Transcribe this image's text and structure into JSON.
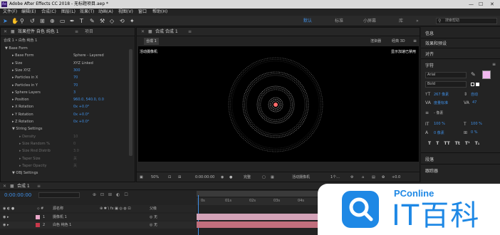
{
  "window": {
    "app_badge": "Ae",
    "title": "Adobe After Effects CC 2018 - 无标题项目.aep *"
  },
  "menu": [
    "文件(F)",
    "编辑(E)",
    "合成(C)",
    "图层(L)",
    "效果(T)",
    "动画(A)",
    "视图(V)",
    "窗口",
    "帮助(H)"
  ],
  "workspaces": {
    "default": "默认",
    "standard": "标准",
    "small": "小屏幕",
    "library": "库"
  },
  "search": {
    "placeholder": "搜索帮助"
  },
  "effects_panel": {
    "tab": "效果控件 自色 纯色 1",
    "project_tab": "项目",
    "breadcrumb": "合成 1 • 白色 纯色 1",
    "rows": [
      {
        "label": "Base Form",
        "indent": 0
      },
      {
        "label": "Base Form",
        "value": "Sphere - Layered",
        "indent": 1
      },
      {
        "label": "Size",
        "value": "XYZ Linked",
        "indent": 1
      },
      {
        "label": "Size XYZ",
        "value": "300",
        "indent": 1
      },
      {
        "label": "Particles in X",
        "value": "70",
        "indent": 1
      },
      {
        "label": "Particles in Y",
        "value": "70",
        "indent": 1
      },
      {
        "label": "Sphere Layers",
        "value": "3",
        "indent": 1
      },
      {
        "label": "Position",
        "value": "960.0, 540.0, 0.0",
        "indent": 1
      },
      {
        "label": "X Rotation",
        "value": "0x +0.0°",
        "indent": 1
      },
      {
        "label": "Y Rotation",
        "value": "0x +0.0°",
        "indent": 1
      },
      {
        "label": "Z Rotation",
        "value": "0x +0.0°",
        "indent": 1
      },
      {
        "label": "String Settings",
        "indent": 1
      },
      {
        "label": "Density",
        "value": "10",
        "indent": 2
      },
      {
        "label": "Size Random %",
        "value": "0",
        "indent": 2
      },
      {
        "label": "Size Rnd Distrib",
        "value": "3.0",
        "indent": 2
      },
      {
        "label": "Taper Size",
        "value": "关",
        "indent": 2
      },
      {
        "label": "Taper Opacity",
        "value": "关",
        "indent": 2
      },
      {
        "label": "OBJ Settings",
        "indent": 1
      }
    ]
  },
  "viewer": {
    "tab": "合成 合成 1",
    "sub_tab": "合成 1",
    "renderer": "渲染器",
    "renderer_value": "经典 3D",
    "camera_label": "活动摄像机",
    "top_right": "显示加速已禁用",
    "zoom": "50%",
    "timecode": "0:00:00:00",
    "quality": "完整",
    "camera_menu": "活动摄像机",
    "views": "1个...",
    "offset": "+0.0"
  },
  "right_panel": {
    "info": "信息",
    "effects": "效果和预设",
    "align": "对齐",
    "character": "字符",
    "font": "Arial",
    "style": "Bold",
    "size": "267 像素",
    "leading": "自动",
    "kerning": "度量标准",
    "tracking": "47",
    "stroke": "- 像素",
    "v_scale": "100 %",
    "h_scale": "100 %",
    "baseline": "0 像素",
    "tsume": "0 %",
    "styles": [
      "T",
      "T",
      "TT",
      "Tt",
      "T¹",
      "T₁"
    ],
    "paragraph": "段落",
    "tracker": "跟踪器",
    "fill_color": "#f0b8ee"
  },
  "timeline": {
    "tab": "合成 1",
    "timecode": "0:00:00:00",
    "col_name": "源名称",
    "col_parent": "父级",
    "layers": [
      {
        "num": "1",
        "name": "摄像机 1",
        "color": "#e8a6c8",
        "parent": "无"
      },
      {
        "num": "2",
        "name": "白色 纯色 1",
        "color": "#c8384a",
        "parent": "无"
      }
    ],
    "ticks": [
      "0s",
      "01s",
      "02s",
      "03s",
      "04s",
      "05s"
    ]
  },
  "watermark": {
    "brand": "PConline",
    "slogan": "IT百科"
  }
}
